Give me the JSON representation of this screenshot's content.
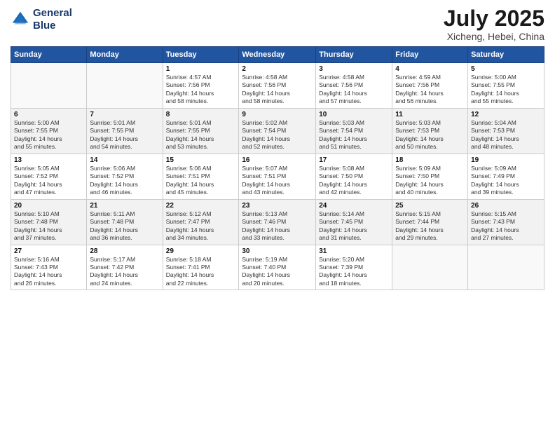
{
  "header": {
    "logo_line1": "General",
    "logo_line2": "Blue",
    "month": "July 2025",
    "location": "Xicheng, Hebei, China"
  },
  "weekdays": [
    "Sunday",
    "Monday",
    "Tuesday",
    "Wednesday",
    "Thursday",
    "Friday",
    "Saturday"
  ],
  "weeks": [
    [
      {
        "day": "",
        "content": ""
      },
      {
        "day": "",
        "content": ""
      },
      {
        "day": "1",
        "content": "Sunrise: 4:57 AM\nSunset: 7:56 PM\nDaylight: 14 hours\nand 58 minutes."
      },
      {
        "day": "2",
        "content": "Sunrise: 4:58 AM\nSunset: 7:56 PM\nDaylight: 14 hours\nand 58 minutes."
      },
      {
        "day": "3",
        "content": "Sunrise: 4:58 AM\nSunset: 7:56 PM\nDaylight: 14 hours\nand 57 minutes."
      },
      {
        "day": "4",
        "content": "Sunrise: 4:59 AM\nSunset: 7:56 PM\nDaylight: 14 hours\nand 56 minutes."
      },
      {
        "day": "5",
        "content": "Sunrise: 5:00 AM\nSunset: 7:55 PM\nDaylight: 14 hours\nand 55 minutes."
      }
    ],
    [
      {
        "day": "6",
        "content": "Sunrise: 5:00 AM\nSunset: 7:55 PM\nDaylight: 14 hours\nand 55 minutes."
      },
      {
        "day": "7",
        "content": "Sunrise: 5:01 AM\nSunset: 7:55 PM\nDaylight: 14 hours\nand 54 minutes."
      },
      {
        "day": "8",
        "content": "Sunrise: 5:01 AM\nSunset: 7:55 PM\nDaylight: 14 hours\nand 53 minutes."
      },
      {
        "day": "9",
        "content": "Sunrise: 5:02 AM\nSunset: 7:54 PM\nDaylight: 14 hours\nand 52 minutes."
      },
      {
        "day": "10",
        "content": "Sunrise: 5:03 AM\nSunset: 7:54 PM\nDaylight: 14 hours\nand 51 minutes."
      },
      {
        "day": "11",
        "content": "Sunrise: 5:03 AM\nSunset: 7:53 PM\nDaylight: 14 hours\nand 50 minutes."
      },
      {
        "day": "12",
        "content": "Sunrise: 5:04 AM\nSunset: 7:53 PM\nDaylight: 14 hours\nand 48 minutes."
      }
    ],
    [
      {
        "day": "13",
        "content": "Sunrise: 5:05 AM\nSunset: 7:52 PM\nDaylight: 14 hours\nand 47 minutes."
      },
      {
        "day": "14",
        "content": "Sunrise: 5:06 AM\nSunset: 7:52 PM\nDaylight: 14 hours\nand 46 minutes."
      },
      {
        "day": "15",
        "content": "Sunrise: 5:06 AM\nSunset: 7:51 PM\nDaylight: 14 hours\nand 45 minutes."
      },
      {
        "day": "16",
        "content": "Sunrise: 5:07 AM\nSunset: 7:51 PM\nDaylight: 14 hours\nand 43 minutes."
      },
      {
        "day": "17",
        "content": "Sunrise: 5:08 AM\nSunset: 7:50 PM\nDaylight: 14 hours\nand 42 minutes."
      },
      {
        "day": "18",
        "content": "Sunrise: 5:09 AM\nSunset: 7:50 PM\nDaylight: 14 hours\nand 40 minutes."
      },
      {
        "day": "19",
        "content": "Sunrise: 5:09 AM\nSunset: 7:49 PM\nDaylight: 14 hours\nand 39 minutes."
      }
    ],
    [
      {
        "day": "20",
        "content": "Sunrise: 5:10 AM\nSunset: 7:48 PM\nDaylight: 14 hours\nand 37 minutes."
      },
      {
        "day": "21",
        "content": "Sunrise: 5:11 AM\nSunset: 7:48 PM\nDaylight: 14 hours\nand 36 minutes."
      },
      {
        "day": "22",
        "content": "Sunrise: 5:12 AM\nSunset: 7:47 PM\nDaylight: 14 hours\nand 34 minutes."
      },
      {
        "day": "23",
        "content": "Sunrise: 5:13 AM\nSunset: 7:46 PM\nDaylight: 14 hours\nand 33 minutes."
      },
      {
        "day": "24",
        "content": "Sunrise: 5:14 AM\nSunset: 7:45 PM\nDaylight: 14 hours\nand 31 minutes."
      },
      {
        "day": "25",
        "content": "Sunrise: 5:15 AM\nSunset: 7:44 PM\nDaylight: 14 hours\nand 29 minutes."
      },
      {
        "day": "26",
        "content": "Sunrise: 5:15 AM\nSunset: 7:43 PM\nDaylight: 14 hours\nand 27 minutes."
      }
    ],
    [
      {
        "day": "27",
        "content": "Sunrise: 5:16 AM\nSunset: 7:43 PM\nDaylight: 14 hours\nand 26 minutes."
      },
      {
        "day": "28",
        "content": "Sunrise: 5:17 AM\nSunset: 7:42 PM\nDaylight: 14 hours\nand 24 minutes."
      },
      {
        "day": "29",
        "content": "Sunrise: 5:18 AM\nSunset: 7:41 PM\nDaylight: 14 hours\nand 22 minutes."
      },
      {
        "day": "30",
        "content": "Sunrise: 5:19 AM\nSunset: 7:40 PM\nDaylight: 14 hours\nand 20 minutes."
      },
      {
        "day": "31",
        "content": "Sunrise: 5:20 AM\nSunset: 7:39 PM\nDaylight: 14 hours\nand 18 minutes."
      },
      {
        "day": "",
        "content": ""
      },
      {
        "day": "",
        "content": ""
      }
    ]
  ]
}
